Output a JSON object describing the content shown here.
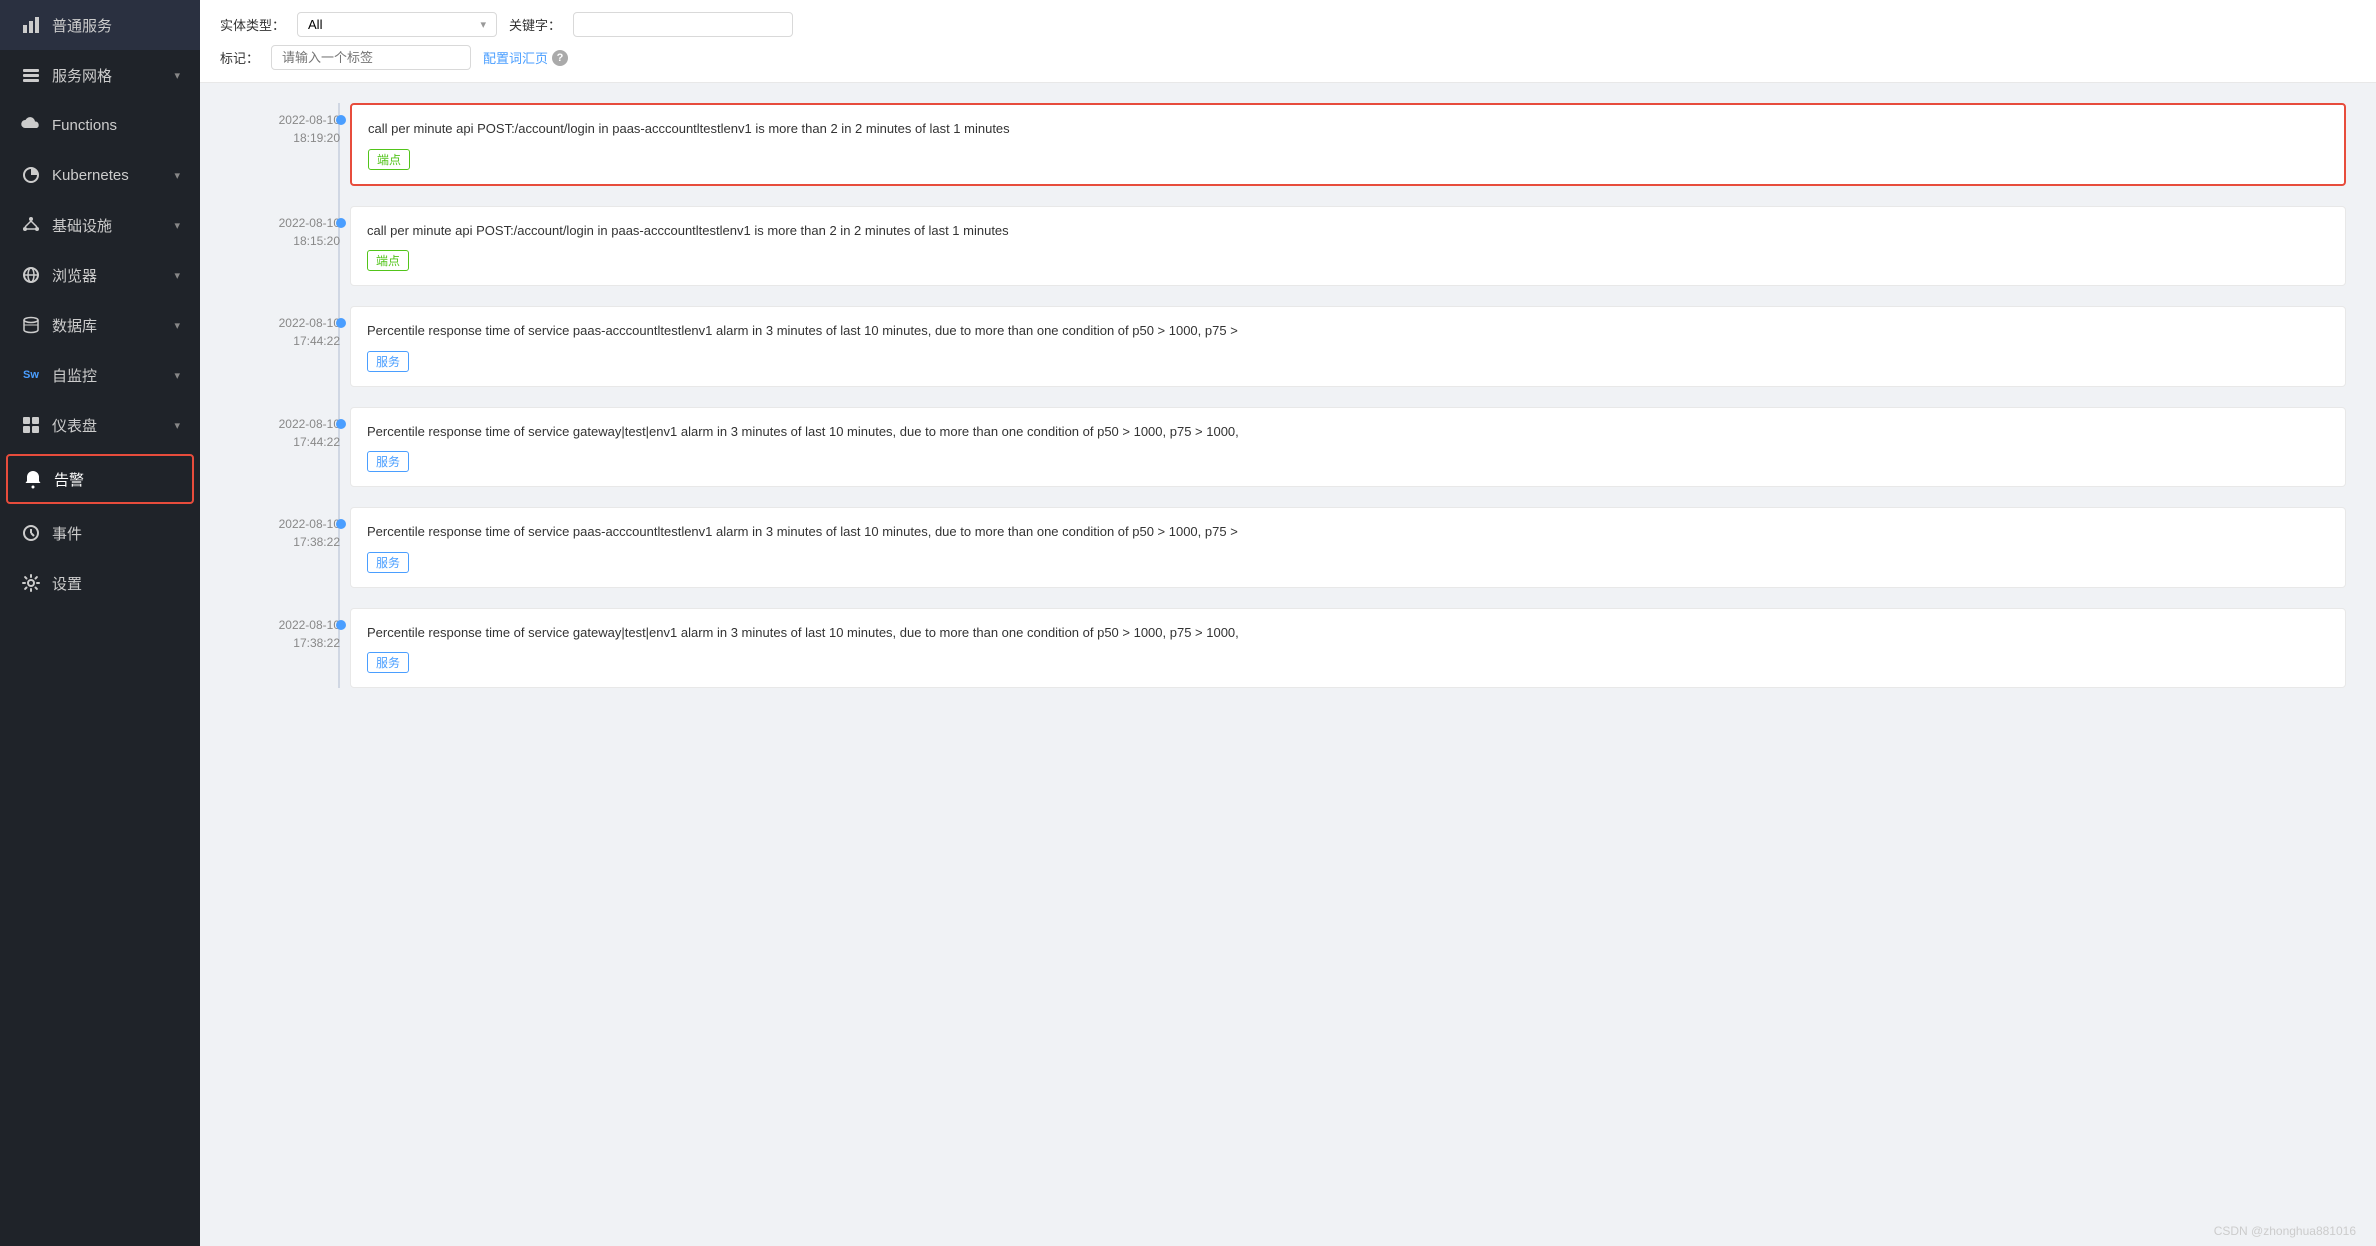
{
  "sidebar": {
    "items": [
      {
        "id": "general-service",
        "label": "普通服务",
        "icon": "bar-chart",
        "hasArrow": false
      },
      {
        "id": "service-mesh",
        "label": "服务网格",
        "icon": "layers",
        "hasArrow": true
      },
      {
        "id": "functions",
        "label": "Functions",
        "icon": "cloud",
        "hasArrow": false
      },
      {
        "id": "kubernetes",
        "label": "Kubernetes",
        "icon": "pie",
        "hasArrow": true
      },
      {
        "id": "infra",
        "label": "基础设施",
        "icon": "nodes",
        "hasArrow": true
      },
      {
        "id": "browser",
        "label": "浏览器",
        "icon": "globe",
        "hasArrow": true
      },
      {
        "id": "database",
        "label": "数据库",
        "icon": "database",
        "hasArrow": true
      },
      {
        "id": "selfmon",
        "label": "自监控",
        "icon": "sw",
        "hasArrow": true
      },
      {
        "id": "dashboard",
        "label": "仪表盘",
        "icon": "grid",
        "hasArrow": true
      },
      {
        "id": "alarm",
        "label": "告警",
        "icon": "bell",
        "hasArrow": false,
        "active": true,
        "highlighted": true
      },
      {
        "id": "events",
        "label": "事件",
        "icon": "clock",
        "hasArrow": false
      },
      {
        "id": "settings",
        "label": "设置",
        "icon": "gear",
        "hasArrow": false
      }
    ]
  },
  "filters": {
    "entity_type_label": "实体类型：",
    "entity_type_value": "All",
    "keyword_label": "关键字：",
    "keyword_placeholder": "",
    "tag_label": "标记：",
    "tag_placeholder": "请输入一个标签",
    "config_link": "配置词汇页"
  },
  "timeline": {
    "items": [
      {
        "id": 1,
        "time_line1": "2022-08-10",
        "time_line2": "18:19:20",
        "text": "call per minute api POST:/account/login in paas-acccountltestlenv1 is more than 2 in 2 minutes of last 1 minutes",
        "tag": "端点",
        "tag_type": "green",
        "highlighted": true
      },
      {
        "id": 2,
        "time_line1": "2022-08-10",
        "time_line2": "18:15:20",
        "text": "call per minute api POST:/account/login in paas-acccountltestlenv1 is more than 2 in 2 minutes of last 1 minutes",
        "tag": "端点",
        "tag_type": "green",
        "highlighted": false
      },
      {
        "id": 3,
        "time_line1": "2022-08-10",
        "time_line2": "17:44:22",
        "text": "Percentile response time of service paas-acccountltestlenv1 alarm in 3 minutes of last 10 minutes, due to more than one condition of p50 > 1000, p75 >",
        "tag": "服务",
        "tag_type": "blue",
        "highlighted": false
      },
      {
        "id": 4,
        "time_line1": "2022-08-10",
        "time_line2": "17:44:22",
        "text": "Percentile response time of service gateway|test|env1 alarm in 3 minutes of last 10 minutes, due to more than one condition of p50 > 1000, p75 > 1000,",
        "tag": "服务",
        "tag_type": "blue",
        "highlighted": false
      },
      {
        "id": 5,
        "time_line1": "2022-08-10",
        "time_line2": "17:38:22",
        "text": "Percentile response time of service paas-acccountltestlenv1 alarm in 3 minutes of last 10 minutes, due to more than one condition of p50 > 1000, p75 >",
        "tag": "服务",
        "tag_type": "blue",
        "highlighted": false
      },
      {
        "id": 6,
        "time_line1": "2022-08-10",
        "time_line2": "17:38:22",
        "text": "Percentile response time of service gateway|test|env1 alarm in 3 minutes of last 10 minutes, due to more than one condition of p50 > 1000, p75 > 1000,",
        "tag": "服务",
        "tag_type": "blue",
        "highlighted": false
      }
    ]
  },
  "watermark": "CSDN @zhonghua881016"
}
